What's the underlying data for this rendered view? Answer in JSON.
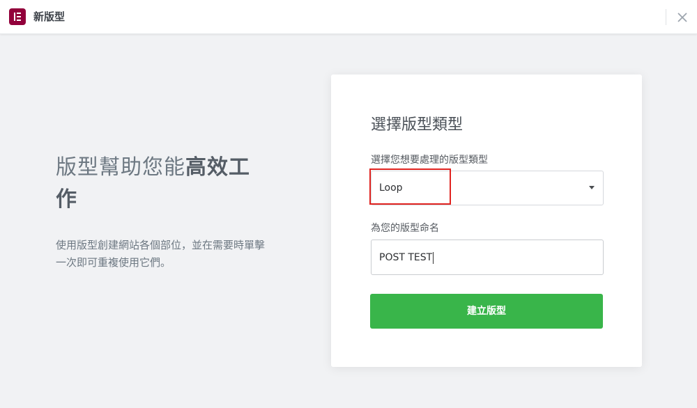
{
  "header": {
    "title": "新版型",
    "logo_icon": "elementor-logo-icon",
    "close_icon": "close-icon",
    "brand_color": "#92003b"
  },
  "intro": {
    "heading_regular": "版型幫助您能",
    "heading_bold_1": "高效工",
    "heading_bold_2": "作",
    "description": "使用版型創建網站各個部位，並在需要時單擊一次即可重複使用它們。"
  },
  "form": {
    "title": "選擇版型類型",
    "type_label": "選擇您想要處理的版型類型",
    "type_selected": "Loop",
    "name_label": "為您的版型命名",
    "name_value": "POST TEST",
    "submit_label": "建立版型",
    "submit_color": "#39b54a",
    "highlight_color": "#e0221f"
  }
}
